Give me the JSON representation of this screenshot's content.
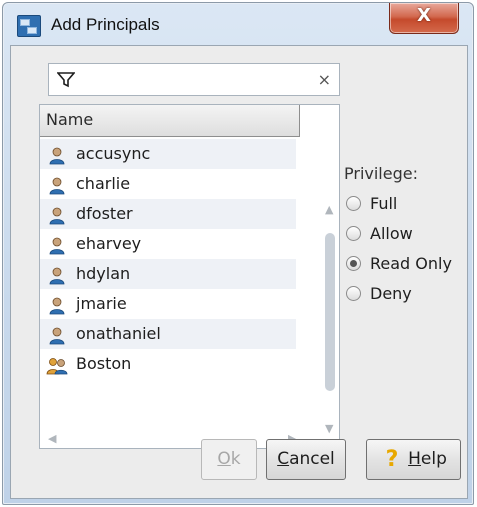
{
  "window": {
    "title": "Add Principals",
    "close_label": "X"
  },
  "filter": {
    "placeholder": "",
    "value": "",
    "clear_label": "×"
  },
  "list": {
    "column_header": "Name",
    "items": [
      {
        "name": "accusync",
        "icon": "user-icon"
      },
      {
        "name": "charlie",
        "icon": "user-icon"
      },
      {
        "name": "dfoster",
        "icon": "user-icon"
      },
      {
        "name": "eharvey",
        "icon": "user-icon"
      },
      {
        "name": "hdylan",
        "icon": "user-icon"
      },
      {
        "name": "jmarie",
        "icon": "user-icon"
      },
      {
        "name": "onathaniel",
        "icon": "user-icon"
      },
      {
        "name": "Boston",
        "icon": "group-icon"
      }
    ]
  },
  "privilege": {
    "label": "Privilege:",
    "options": [
      {
        "label": "Full",
        "checked": false
      },
      {
        "label": "Allow",
        "checked": false
      },
      {
        "label": "Read Only",
        "checked": true
      },
      {
        "label": "Deny",
        "checked": false
      }
    ]
  },
  "buttons": {
    "ok": {
      "mnemonic": "O",
      "rest": "k",
      "enabled": false
    },
    "cancel": {
      "mnemonic": "C",
      "rest": "ancel"
    },
    "help": {
      "mnemonic": "H",
      "rest": "elp"
    }
  },
  "colors": {
    "close_button": "#c54a2c",
    "user_icon": "#2f6fb1",
    "help_icon": "#e8a800"
  }
}
